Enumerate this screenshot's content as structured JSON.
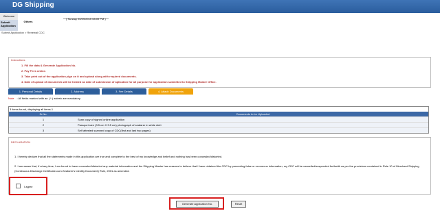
{
  "header": {
    "title": "DG Shipping"
  },
  "menu": {
    "welcome": "Welcome",
    "submit_application": "Submit Application",
    "others": "Others",
    "date": "( Sunday 20/09/2015 08:09 PM )"
  },
  "breadcrumb": {
    "text": "Submit Application  >  Renewal CDC"
  },
  "instructions": {
    "label": "Instructions",
    "items": [
      "1. Fill the data & Generate Application No.",
      "2. Pay Fees online.",
      "3. Take print out of the application,sign on it and upload along with required documents.",
      "4. Date of upload of documents will be treated as date of submission of aplication for all purpose for application submitted to Shipping Master Office."
    ]
  },
  "tabs": [
    {
      "label": "1. Personal Details"
    },
    {
      "label": "2. Address"
    },
    {
      "label": "3. Fee Details"
    },
    {
      "label": "4. Attach Documents"
    }
  ],
  "note": {
    "label": "Note",
    "text": ": All fields marked with an ( * ) asterix are mandatory."
  },
  "documents": {
    "found_text": "3 items found, displaying all items.1",
    "headers": [
      "Sr.No.",
      "Documents to be Uploaded"
    ],
    "rows": [
      [
        "1",
        "Scan copy of signed online application"
      ],
      [
        "2",
        "Passport size (3.5 cm X 3.5 cm) photograph of seafarer in white shirt"
      ],
      [
        "3",
        "Self attested scanned copy of CDC(first and last two pages)"
      ]
    ]
  },
  "declaration": {
    "label": "DECLARATION",
    "p1": "1.   I hereby declare that all the statements made in this application are true and complete to the best of my knowledge and belief and nothing has been concealed/distorted.",
    "p2": "2.   I am aware that, if at any time, I am found to have concealed/distorted any material information and the Shipping Master has reasons to believe that I have obtained the CDC by presenting false or erroneous information, my CDC will be cancelled/suspended forthwith as per the provisions contained in Rule 10 of Merchant Shipping (Continuous Discharge Certificate-cum-Seafarer's Identity Document) Rule, 2001 as amended.",
    "agree_label": "I agree"
  },
  "buttons": {
    "generate": "Generate Application No.",
    "reset": "Reset"
  }
}
